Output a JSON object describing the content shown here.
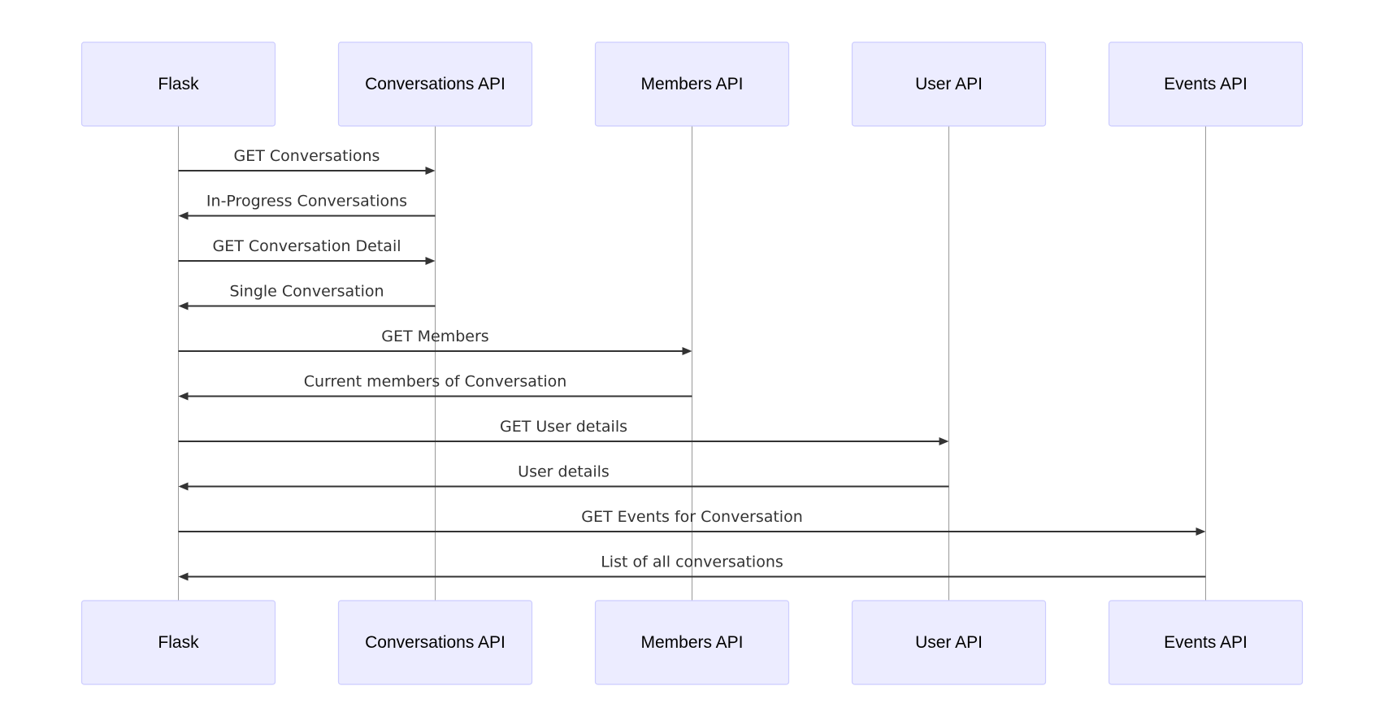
{
  "diagram": {
    "type": "sequence",
    "participants": [
      {
        "id": "flask",
        "label": "Flask"
      },
      {
        "id": "conversations",
        "label": "Conversations API"
      },
      {
        "id": "members",
        "label": "Members API"
      },
      {
        "id": "user",
        "label": "User API"
      },
      {
        "id": "events",
        "label": "Events API"
      }
    ],
    "messages": [
      {
        "from": "flask",
        "to": "conversations",
        "label": "GET Conversations"
      },
      {
        "from": "conversations",
        "to": "flask",
        "label": "In-Progress Conversations"
      },
      {
        "from": "flask",
        "to": "conversations",
        "label": "GET Conversation Detail"
      },
      {
        "from": "conversations",
        "to": "flask",
        "label": "Single Conversation"
      },
      {
        "from": "flask",
        "to": "members",
        "label": "GET Members"
      },
      {
        "from": "members",
        "to": "flask",
        "label": "Current members of Conversation"
      },
      {
        "from": "flask",
        "to": "user",
        "label": "GET User details"
      },
      {
        "from": "user",
        "to": "flask",
        "label": "User details"
      },
      {
        "from": "flask",
        "to": "events",
        "label": "GET Events for Conversation"
      },
      {
        "from": "events",
        "to": "flask",
        "label": "List of all conversations"
      }
    ],
    "colors": {
      "actor_fill": "#ECECFF",
      "actor_border": "#CCCCFF",
      "lifeline": "#999999",
      "message": "#333333"
    }
  }
}
